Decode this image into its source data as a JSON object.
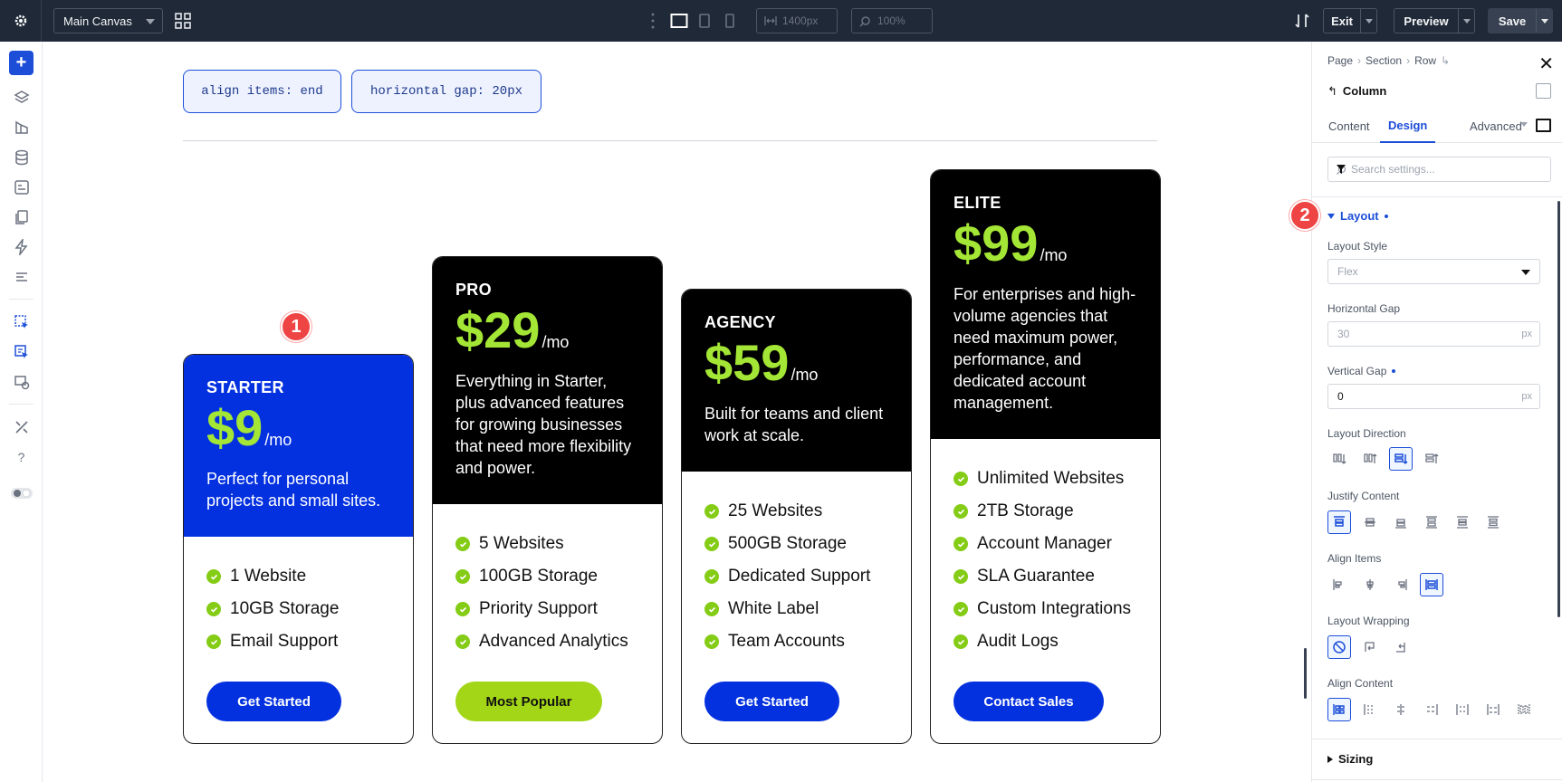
{
  "topbar": {
    "canvas_select": "Main Canvas",
    "width_value": "1400px",
    "zoom_value": "100%",
    "exit_label": "Exit",
    "preview_label": "Preview",
    "save_label": "Save"
  },
  "canvas": {
    "chips": [
      "align items: end",
      "horizontal gap: 20px"
    ],
    "markers": [
      "1",
      "2"
    ],
    "cards": [
      {
        "tier": "STARTER",
        "price": "$9",
        "period": "/mo",
        "description": "Perfect for personal projects and small sites.",
        "features": [
          "1 Website",
          "10GB Storage",
          "Email Support"
        ],
        "cta": "Get Started"
      },
      {
        "tier": "PRO",
        "price": "$29",
        "period": "/mo",
        "description": "Everything in Starter, plus advanced features for growing businesses that need more flexibility and power.",
        "features": [
          "5 Websites",
          "100GB Storage",
          "Priority Support",
          "Advanced Analytics"
        ],
        "cta": "Most Popular"
      },
      {
        "tier": "AGENCY",
        "price": "$59",
        "period": "/mo",
        "description": "Built for teams and client work at scale.",
        "features": [
          "25 Websites",
          "500GB Storage",
          "Dedicated Support",
          "White Label",
          "Team Accounts"
        ],
        "cta": "Get Started"
      },
      {
        "tier": "ELITE",
        "price": "$99",
        "period": "/mo",
        "description": "For enterprises and high-volume agencies that need maximum power, performance, and dedicated account management.",
        "features": [
          "Unlimited Websites",
          "2TB Storage",
          "Account Manager",
          "SLA Guarantee",
          "Custom Integrations",
          "Audit Logs"
        ],
        "cta": "Contact Sales"
      }
    ]
  },
  "panel": {
    "breadcrumb": [
      "Page",
      "Section",
      "Row"
    ],
    "title": "Column",
    "tabs": [
      "Content",
      "Design",
      "Advanced"
    ],
    "search_placeholder": "Search settings...",
    "layout_section": "Layout",
    "layout_style_label": "Layout Style",
    "layout_style_value": "Flex",
    "horizontal_gap_label": "Horizontal Gap",
    "horizontal_gap_placeholder": "30",
    "vertical_gap_label": "Vertical Gap",
    "vertical_gap_value": "0",
    "unit": "px",
    "layout_direction_label": "Layout Direction",
    "justify_content_label": "Justify Content",
    "align_items_label": "Align Items",
    "layout_wrapping_label": "Layout Wrapping",
    "align_content_label": "Align Content",
    "sizing_section": "Sizing"
  },
  "colors": {
    "accent": "#1d4ed8",
    "starter_blue": "#0431e0",
    "lime": "#a3e635",
    "marker_red": "#ef4444"
  }
}
